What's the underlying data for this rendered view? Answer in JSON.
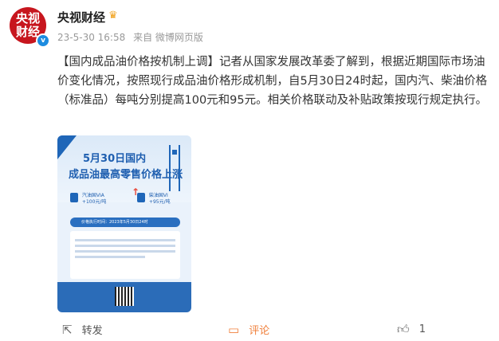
{
  "author": {
    "avatar_text_line1": "央视",
    "avatar_text_line2": "财经",
    "name": "央视财经",
    "badge_icon": "crown-icon"
  },
  "meta": {
    "time": "23-5-30 16:58",
    "source": "来自 微博网页版"
  },
  "post": {
    "text": "【国内成品油价格按机制上调】记者从国家发展改革委了解到，根据近期国际市场油价变化情况，按照现行成品油价格形成机制，自5月30日24时起，国内汽、柴油价格（标准品）每吨分别提高100元和95元。相关价格联动及补贴政策按现行规定执行。"
  },
  "poster": {
    "title_line1": "5月30日国内",
    "title_line2": "成品油最高零售价格上涨",
    "gas_label": "汽油国VIA",
    "gas_value": "+100元/吨",
    "diesel_label": "柴油国VI",
    "diesel_value": "+95元/吨",
    "exec_text": "价格执行时间：2023年5月30日24时"
  },
  "actions": {
    "repost": "转发",
    "comment": "评论",
    "like_count": "1"
  }
}
